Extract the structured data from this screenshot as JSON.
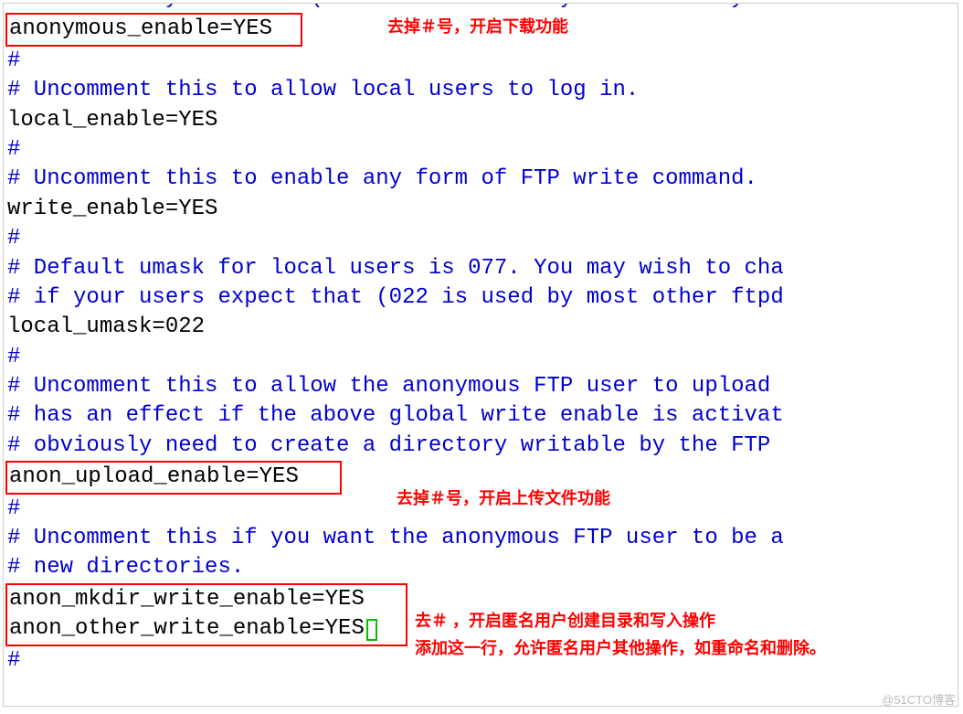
{
  "lines": {
    "l0": "# Allow anonymous FTP? (Beware - allowed by default if you",
    "l1": "anonymous_enable=YES",
    "l2": "#",
    "l3": "# Uncomment this to allow local users to log in.",
    "l4": "local_enable=YES",
    "l5": "#",
    "l6": "# Uncomment this to enable any form of FTP write command.",
    "l7": "write_enable=YES",
    "l8": "#",
    "l9": "# Default umask for local users is 077. You may wish to cha",
    "l10": "# if your users expect that (022 is used by most other ftpd",
    "l11": "local_umask=022",
    "l12": "#",
    "l13": "# Uncomment this to allow the anonymous FTP user to upload ",
    "l14": "# has an effect if the above global write enable is activat",
    "l15": "# obviously need to create a directory writable by the FTP ",
    "l16": "anon_upload_enable=YES",
    "l17": "#",
    "l18": "# Uncomment this if you want the anonymous FTP user to be a",
    "l19": "# new directories.",
    "l20": "anon_mkdir_write_enable=YES",
    "l21": "anon_other_write_enable=YES",
    "l22": "#"
  },
  "annotations": {
    "a1": "去掉＃号，开启下载功能",
    "a2": "去掉＃号，开启上传文件功能",
    "a3_line1": "去＃ ，开启匿名用户创建目录和写入操作",
    "a3_line2": "添加这一行，允许匿名用户其他操作，如重命名和删除。"
  },
  "watermark": "@51CTO博客"
}
